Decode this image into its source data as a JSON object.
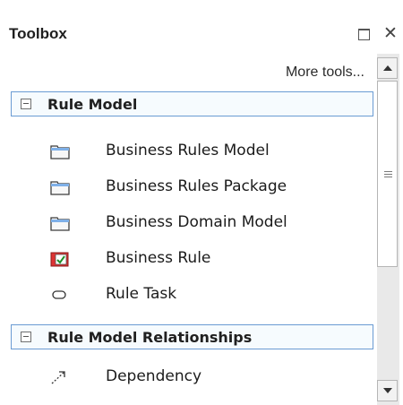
{
  "window": {
    "title": "Toolbox"
  },
  "toolbar": {
    "more_tools_label": "More tools..."
  },
  "icons": {
    "restore": "restore-window-icon",
    "close": "close-icon",
    "scroll_up": "scroll-up-arrow-icon",
    "scroll_down": "scroll-down-arrow-icon"
  },
  "groups": [
    {
      "label": "Rule Model",
      "expanded": true,
      "items": [
        {
          "label": "Business Rules Model",
          "icon": "package-folder-icon"
        },
        {
          "label": "Business Rules Package",
          "icon": "package-folder-icon"
        },
        {
          "label": "Business Domain Model",
          "icon": "package-folder-icon"
        },
        {
          "label": "Business Rule",
          "icon": "business-rule-icon"
        },
        {
          "label": "Rule Task",
          "icon": "rule-task-icon"
        }
      ]
    },
    {
      "label": "Rule Model Relationships",
      "expanded": true,
      "items": [
        {
          "label": "Dependency",
          "icon": "dependency-arrow-icon"
        }
      ]
    }
  ],
  "colors": {
    "group_border": "#6a9bd3",
    "group_background": "#f6fbfe"
  }
}
